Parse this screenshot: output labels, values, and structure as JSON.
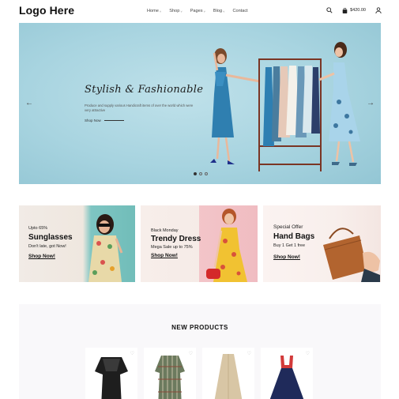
{
  "header": {
    "logo": "Logo Here",
    "nav": [
      {
        "label": "Home"
      },
      {
        "label": "Shop"
      },
      {
        "label": "Pages"
      },
      {
        "label": "Blog"
      },
      {
        "label": "Contact"
      }
    ],
    "cart_total": "$420.00"
  },
  "hero": {
    "title": "Stylish & Fashionable",
    "subtitle": "Produce and supply various Handicraft items of over the world which were very attractive",
    "cta": "Shop Now"
  },
  "promos": [
    {
      "line1": "Upto 65%",
      "big": "Sunglasses",
      "line2": "Don't late, got Now!",
      "cta": "Shop Now!"
    },
    {
      "line1": "Black Monday",
      "big": "Trendy Dress",
      "line2": "Mega Sale up to 75%",
      "cta": "Shop Now!"
    },
    {
      "line1": "Special Offer",
      "big": "Hand Bags",
      "line2": "Buy 1 Get 1 free",
      "cta": "Shop Now!"
    }
  ],
  "products": {
    "title": "NEW PRODUCTS",
    "items": [
      {
        "color": "#1e1e1e"
      },
      {
        "color": "#5e6b52"
      },
      {
        "color": "#d8c6a5"
      },
      {
        "color": "#1f2a5a"
      }
    ]
  },
  "colors": {
    "hero_bg": "#a8d4e0",
    "promo_teal": "#71bdb9",
    "promo_pink": "#f0bcc1"
  }
}
